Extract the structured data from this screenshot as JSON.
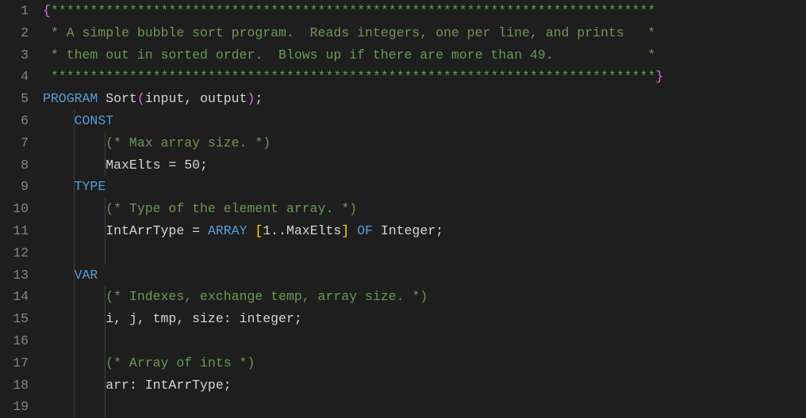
{
  "line_count": 19,
  "indent_guides": [
    1,
    2
  ],
  "lines": [
    {
      "indent_guides": [],
      "tokens": [
        {
          "cls": "tok-brace",
          "t": "{"
        },
        {
          "cls": "tok-comment",
          "t": "*****************************************************************************"
        }
      ]
    },
    {
      "indent_guides": [],
      "tokens": [
        {
          "cls": "tok-comment",
          "t": " * A simple bubble sort program.  Reads integers, one per line, and prints   *"
        }
      ]
    },
    {
      "indent_guides": [],
      "tokens": [
        {
          "cls": "tok-comment",
          "t": " * them out in sorted order.  Blows up if there are more than 49.            *"
        }
      ]
    },
    {
      "indent_guides": [],
      "tokens": [
        {
          "cls": "tok-comment",
          "t": " *****************************************************************************"
        },
        {
          "cls": "tok-brace",
          "t": "}"
        }
      ]
    },
    {
      "indent_guides": [],
      "tokens": [
        {
          "cls": "tok-keyword",
          "t": "PROGRAM"
        },
        {
          "cls": "tok-ident",
          "t": " Sort"
        },
        {
          "cls": "tok-paren",
          "t": "("
        },
        {
          "cls": "tok-ident",
          "t": "input"
        },
        {
          "cls": "tok-punct",
          "t": ", "
        },
        {
          "cls": "tok-ident",
          "t": "output"
        },
        {
          "cls": "tok-paren",
          "t": ")"
        },
        {
          "cls": "tok-punct",
          "t": ";"
        }
      ]
    },
    {
      "indent_guides": [
        1
      ],
      "tokens": [
        {
          "cls": "tok-ident",
          "t": "    "
        },
        {
          "cls": "tok-keyword",
          "t": "CONST"
        }
      ]
    },
    {
      "indent_guides": [
        1,
        2
      ],
      "tokens": [
        {
          "cls": "tok-ident",
          "t": "        "
        },
        {
          "cls": "tok-comment",
          "t": "(* Max array size. *)"
        }
      ]
    },
    {
      "indent_guides": [
        1,
        2
      ],
      "tokens": [
        {
          "cls": "tok-ident",
          "t": "        MaxElts = "
        },
        {
          "cls": "tok-number",
          "t": "50"
        },
        {
          "cls": "tok-punct",
          "t": ";"
        }
      ]
    },
    {
      "indent_guides": [
        1
      ],
      "tokens": [
        {
          "cls": "tok-ident",
          "t": "    "
        },
        {
          "cls": "tok-keyword",
          "t": "TYPE"
        }
      ]
    },
    {
      "indent_guides": [
        1,
        2
      ],
      "tokens": [
        {
          "cls": "tok-ident",
          "t": "        "
        },
        {
          "cls": "tok-comment",
          "t": "(* Type of the element array. *)"
        }
      ]
    },
    {
      "indent_guides": [
        1,
        2
      ],
      "tokens": [
        {
          "cls": "tok-ident",
          "t": "        IntArrType = "
        },
        {
          "cls": "tok-keyword",
          "t": "ARRAY"
        },
        {
          "cls": "tok-ident",
          "t": " "
        },
        {
          "cls": "tok-bracket",
          "t": "["
        },
        {
          "cls": "tok-number",
          "t": "1"
        },
        {
          "cls": "tok-punct",
          "t": ".."
        },
        {
          "cls": "tok-ident",
          "t": "MaxElts"
        },
        {
          "cls": "tok-bracket",
          "t": "]"
        },
        {
          "cls": "tok-ident",
          "t": " "
        },
        {
          "cls": "tok-keyword",
          "t": "OF"
        },
        {
          "cls": "tok-ident",
          "t": " Integer"
        },
        {
          "cls": "tok-punct",
          "t": ";"
        }
      ]
    },
    {
      "indent_guides": [
        1,
        2
      ],
      "tokens": []
    },
    {
      "indent_guides": [
        1
      ],
      "tokens": [
        {
          "cls": "tok-ident",
          "t": "    "
        },
        {
          "cls": "tok-keyword",
          "t": "VAR"
        }
      ]
    },
    {
      "indent_guides": [
        1,
        2
      ],
      "tokens": [
        {
          "cls": "tok-ident",
          "t": "        "
        },
        {
          "cls": "tok-comment",
          "t": "(* Indexes, exchange temp, array size. *)"
        }
      ]
    },
    {
      "indent_guides": [
        1,
        2
      ],
      "tokens": [
        {
          "cls": "tok-ident",
          "t": "        i, j, tmp, size: integer;"
        }
      ]
    },
    {
      "indent_guides": [
        1,
        2
      ],
      "tokens": []
    },
    {
      "indent_guides": [
        1,
        2
      ],
      "tokens": [
        {
          "cls": "tok-ident",
          "t": "        "
        },
        {
          "cls": "tok-comment",
          "t": "(* Array of ints *)"
        }
      ]
    },
    {
      "indent_guides": [
        1,
        2
      ],
      "tokens": [
        {
          "cls": "tok-ident",
          "t": "        arr: IntArrType;"
        }
      ]
    },
    {
      "indent_guides": [
        1,
        2
      ],
      "tokens": []
    }
  ]
}
